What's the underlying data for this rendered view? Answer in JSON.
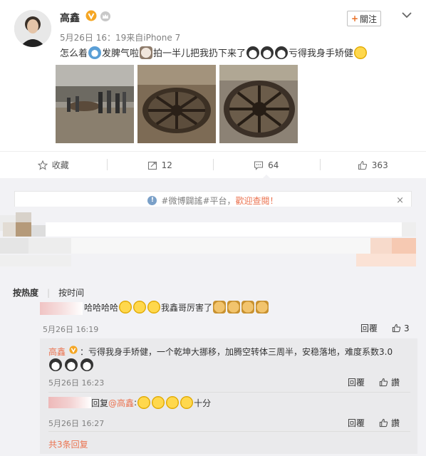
{
  "post": {
    "author": "高鑫",
    "meta": "5月26日 16：19来自iPhone 7",
    "follow_label": "關注",
    "text_parts": [
      "怎么着",
      "发脾气啦",
      "拍一半儿把我扔下来了",
      "亏得我身手矫健"
    ],
    "actions": {
      "bookmark": "收藏",
      "forward": "12",
      "comment": "64",
      "like": "363"
    }
  },
  "notice": {
    "prefix": "#微博闢謠#平台，",
    "highlight": "歡迎查閱！",
    "close": "×"
  },
  "sort": {
    "hot": "按热度",
    "time": "按时间"
  },
  "comment1": {
    "text_a": "哈哈哈哈",
    "text_b": "我鑫哥厉害了",
    "time": "5月26日 16:19",
    "reply": "回覆",
    "like_count": "3"
  },
  "reply1": {
    "author": "高鑫",
    "text": "：亏得我身手矫健，一个乾坤大挪移，加腾空转体三周半，安稳落地，难度系数3.0",
    "time": "5月26日 16:23",
    "reply": "回覆",
    "like": "讚"
  },
  "reply2": {
    "prefix": "回复",
    "at": "@高鑫",
    "colon": ":",
    "suffix": "十分",
    "time": "5月26日 16:27",
    "reply": "回覆",
    "like": "讚"
  },
  "more": "共3条回复",
  "colors": {
    "accent": "#eb7350",
    "vip": "#f5a623"
  }
}
